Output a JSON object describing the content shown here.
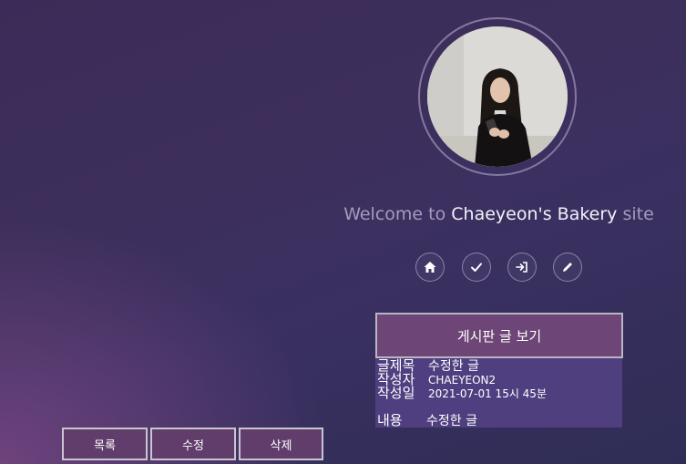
{
  "profile": {
    "welcome_prefix": "Welcome to",
    "site_name": "Chaeyeon's Bakery",
    "welcome_suffix": "site"
  },
  "nav_icons": [
    "home-icon",
    "check-icon",
    "sign-in-icon",
    "pencil-icon"
  ],
  "board": {
    "title": "게시판 글 보기",
    "fields": {
      "subject_label": "글제목",
      "subject_value": "수정한 글",
      "author_label": "작성자",
      "author_value": "CHAEYEON2",
      "date_label": "작성일",
      "date_value": "2021-07-01 15시 45분",
      "content_label": "내용",
      "content_value": "수정한 글"
    }
  },
  "actions": {
    "list_label": "목록",
    "edit_label": "수정",
    "delete_label": "삭제"
  },
  "colors": {
    "accent": "#6e4577",
    "button_bg": "#613d6b"
  }
}
